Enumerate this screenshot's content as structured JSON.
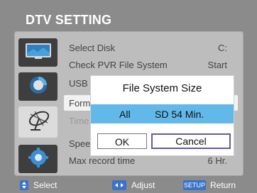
{
  "header": {
    "title": "DTV SETTING"
  },
  "menu": {
    "items": [
      {
        "label": "Select Disk",
        "value": "C:"
      },
      {
        "label": "Check PVR File System",
        "value": "Start"
      },
      {
        "label": "USB",
        "value": ""
      },
      {
        "label": "Form",
        "value": ""
      },
      {
        "label": "Time",
        "value": ""
      },
      {
        "label": "Spee",
        "value": ""
      },
      {
        "label": "Max record time",
        "value": "6 Hr."
      }
    ]
  },
  "dialog": {
    "title": "File System Size",
    "option_left": "All",
    "option_right": "SD 54 Min.",
    "ok_label": "OK",
    "cancel_label": "Cancel"
  },
  "footer": {
    "select_label": "Select",
    "adjust_label": "Adjust",
    "setup_key": "SETUP",
    "return_label": "Return"
  },
  "colors": {
    "accent_blue": "#63b8ea",
    "cancel_border": "#6b57a4",
    "footer_key": "#3a73c8",
    "panel": "#bdbdbd"
  },
  "icons": [
    "tv-icon",
    "record-icon",
    "satellite-icon",
    "settings-icon",
    "up-down-arrows-icon",
    "left-right-arrows-icon"
  ]
}
